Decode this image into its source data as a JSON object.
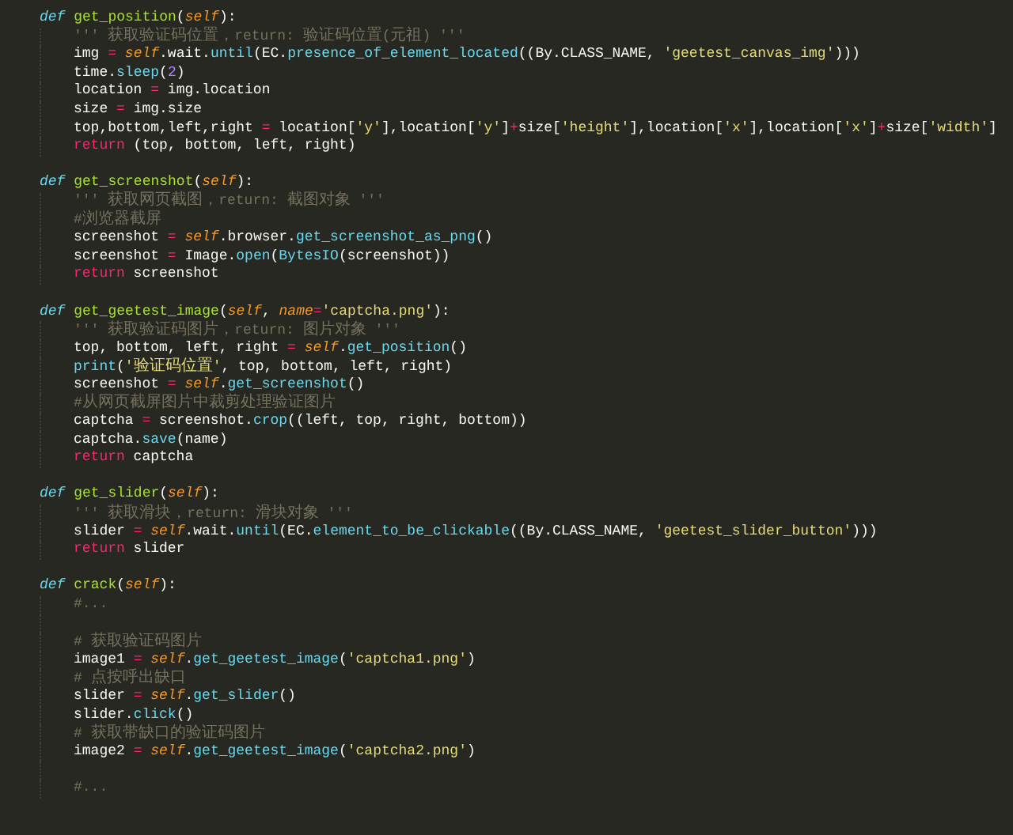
{
  "editor": {
    "lines": [
      {
        "kind": "code",
        "tokens": [
          {
            "kind": "kw",
            "text": "def "
          },
          {
            "kind": "fn",
            "text": "get_position"
          },
          {
            "kind": "plain",
            "text": "("
          },
          {
            "kind": "self",
            "text": "self"
          },
          {
            "kind": "plain",
            "text": "):"
          }
        ],
        "children": [
          {
            "kind": "code",
            "tokens": [
              {
                "kind": "cmt",
                "text": "''' 获取验证码位置，return: 验证码位置(元祖) '''"
              }
            ]
          },
          {
            "kind": "code",
            "tokens": [
              {
                "kind": "plain",
                "text": "img "
              },
              {
                "kind": "op",
                "text": "="
              },
              {
                "kind": "self",
                "text": " self"
              },
              {
                "kind": "plain",
                "text": ".wait."
              },
              {
                "kind": "call",
                "text": "until"
              },
              {
                "kind": "plain",
                "text": "(EC."
              },
              {
                "kind": "call",
                "text": "presence_of_element_located"
              },
              {
                "kind": "plain",
                "text": "((By.CLASS_NAME, "
              },
              {
                "kind": "str",
                "text": "'geetest_canvas_img'"
              },
              {
                "kind": "plain",
                "text": ")))"
              }
            ]
          },
          {
            "kind": "code",
            "tokens": [
              {
                "kind": "plain",
                "text": "time."
              },
              {
                "kind": "call",
                "text": "sleep"
              },
              {
                "kind": "plain",
                "text": "("
              },
              {
                "kind": "num",
                "text": "2"
              },
              {
                "kind": "plain",
                "text": ")"
              }
            ]
          },
          {
            "kind": "code",
            "tokens": [
              {
                "kind": "plain",
                "text": "location "
              },
              {
                "kind": "op",
                "text": "="
              },
              {
                "kind": "plain",
                "text": " img.location"
              }
            ]
          },
          {
            "kind": "code",
            "tokens": [
              {
                "kind": "plain",
                "text": "size "
              },
              {
                "kind": "op",
                "text": "="
              },
              {
                "kind": "plain",
                "text": " img.size"
              }
            ]
          },
          {
            "kind": "code",
            "tokens": [
              {
                "kind": "plain",
                "text": "top,bottom,left,right "
              },
              {
                "kind": "op",
                "text": "="
              },
              {
                "kind": "plain",
                "text": " location["
              },
              {
                "kind": "str",
                "text": "'y'"
              },
              {
                "kind": "plain",
                "text": "],location["
              },
              {
                "kind": "str",
                "text": "'y'"
              },
              {
                "kind": "plain",
                "text": "]"
              },
              {
                "kind": "op",
                "text": "+"
              },
              {
                "kind": "plain",
                "text": "size["
              },
              {
                "kind": "str",
                "text": "'height'"
              },
              {
                "kind": "plain",
                "text": "],location["
              },
              {
                "kind": "str",
                "text": "'x'"
              },
              {
                "kind": "plain",
                "text": "],location["
              },
              {
                "kind": "str",
                "text": "'x'"
              },
              {
                "kind": "plain",
                "text": "]"
              },
              {
                "kind": "op",
                "text": "+"
              },
              {
                "kind": "plain",
                "text": "size["
              },
              {
                "kind": "str",
                "text": "'width'"
              },
              {
                "kind": "plain",
                "text": "]"
              }
            ]
          },
          {
            "kind": "code",
            "tokens": [
              {
                "kind": "ret",
                "text": "return"
              },
              {
                "kind": "plain",
                "text": " (top, bottom, left, right)"
              }
            ]
          }
        ]
      },
      {
        "kind": "blank"
      },
      {
        "kind": "code",
        "tokens": [
          {
            "kind": "kw",
            "text": "def "
          },
          {
            "kind": "fn",
            "text": "get_screenshot"
          },
          {
            "kind": "plain",
            "text": "("
          },
          {
            "kind": "self",
            "text": "self"
          },
          {
            "kind": "plain",
            "text": "):"
          }
        ],
        "children": [
          {
            "kind": "code",
            "tokens": [
              {
                "kind": "cmt",
                "text": "''' 获取网页截图，return: 截图对象 '''"
              }
            ]
          },
          {
            "kind": "code",
            "tokens": [
              {
                "kind": "cmt",
                "text": "#浏览器截屏"
              }
            ]
          },
          {
            "kind": "code",
            "tokens": [
              {
                "kind": "plain",
                "text": "screenshot "
              },
              {
                "kind": "op",
                "text": "="
              },
              {
                "kind": "self",
                "text": " self"
              },
              {
                "kind": "plain",
                "text": ".browser."
              },
              {
                "kind": "call",
                "text": "get_screenshot_as_png"
              },
              {
                "kind": "plain",
                "text": "()"
              }
            ]
          },
          {
            "kind": "code",
            "tokens": [
              {
                "kind": "plain",
                "text": "screenshot "
              },
              {
                "kind": "op",
                "text": "="
              },
              {
                "kind": "plain",
                "text": " Image."
              },
              {
                "kind": "call",
                "text": "open"
              },
              {
                "kind": "plain",
                "text": "("
              },
              {
                "kind": "call",
                "text": "BytesIO"
              },
              {
                "kind": "plain",
                "text": "(screenshot))"
              }
            ]
          },
          {
            "kind": "code",
            "tokens": [
              {
                "kind": "ret",
                "text": "return"
              },
              {
                "kind": "plain",
                "text": " screenshot"
              }
            ]
          }
        ]
      },
      {
        "kind": "blank"
      },
      {
        "kind": "code",
        "tokens": [
          {
            "kind": "kw",
            "text": "def "
          },
          {
            "kind": "fn",
            "text": "get_geetest_image"
          },
          {
            "kind": "plain",
            "text": "("
          },
          {
            "kind": "self",
            "text": "self"
          },
          {
            "kind": "plain",
            "text": ", "
          },
          {
            "kind": "self",
            "text": "name"
          },
          {
            "kind": "op",
            "text": "="
          },
          {
            "kind": "str",
            "text": "'captcha.png'"
          },
          {
            "kind": "plain",
            "text": "):"
          }
        ],
        "children": [
          {
            "kind": "code",
            "tokens": [
              {
                "kind": "cmt",
                "text": "''' 获取验证码图片，return: 图片对象 '''"
              }
            ]
          },
          {
            "kind": "code",
            "tokens": [
              {
                "kind": "plain",
                "text": "top, bottom, left, right "
              },
              {
                "kind": "op",
                "text": "="
              },
              {
                "kind": "self",
                "text": " self"
              },
              {
                "kind": "plain",
                "text": "."
              },
              {
                "kind": "call",
                "text": "get_position"
              },
              {
                "kind": "plain",
                "text": "()"
              }
            ]
          },
          {
            "kind": "code",
            "tokens": [
              {
                "kind": "call",
                "text": "print"
              },
              {
                "kind": "plain",
                "text": "("
              },
              {
                "kind": "str",
                "text": "'验证码位置'"
              },
              {
                "kind": "plain",
                "text": ", top, bottom, left, right)"
              }
            ]
          },
          {
            "kind": "code",
            "tokens": [
              {
                "kind": "plain",
                "text": "screenshot "
              },
              {
                "kind": "op",
                "text": "="
              },
              {
                "kind": "self",
                "text": " self"
              },
              {
                "kind": "plain",
                "text": "."
              },
              {
                "kind": "call",
                "text": "get_screenshot"
              },
              {
                "kind": "plain",
                "text": "()"
              }
            ]
          },
          {
            "kind": "code",
            "tokens": [
              {
                "kind": "cmt",
                "text": "#从网页截屏图片中裁剪处理验证图片"
              }
            ]
          },
          {
            "kind": "code",
            "tokens": [
              {
                "kind": "plain",
                "text": "captcha "
              },
              {
                "kind": "op",
                "text": "="
              },
              {
                "kind": "plain",
                "text": " screenshot."
              },
              {
                "kind": "call",
                "text": "crop"
              },
              {
                "kind": "plain",
                "text": "((left, top, right, bottom))"
              }
            ]
          },
          {
            "kind": "code",
            "tokens": [
              {
                "kind": "plain",
                "text": "captcha."
              },
              {
                "kind": "call",
                "text": "save"
              },
              {
                "kind": "plain",
                "text": "(name)"
              }
            ]
          },
          {
            "kind": "code",
            "tokens": [
              {
                "kind": "ret",
                "text": "return"
              },
              {
                "kind": "plain",
                "text": " captcha"
              }
            ]
          }
        ]
      },
      {
        "kind": "blank"
      },
      {
        "kind": "code",
        "tokens": [
          {
            "kind": "kw",
            "text": "def "
          },
          {
            "kind": "fn",
            "text": "get_slider"
          },
          {
            "kind": "plain",
            "text": "("
          },
          {
            "kind": "self",
            "text": "self"
          },
          {
            "kind": "plain",
            "text": "):"
          }
        ],
        "children": [
          {
            "kind": "code",
            "tokens": [
              {
                "kind": "cmt",
                "text": "''' 获取滑块，return: 滑块对象 '''"
              }
            ]
          },
          {
            "kind": "code",
            "tokens": [
              {
                "kind": "plain",
                "text": "slider "
              },
              {
                "kind": "op",
                "text": "="
              },
              {
                "kind": "self",
                "text": " self"
              },
              {
                "kind": "plain",
                "text": ".wait."
              },
              {
                "kind": "call",
                "text": "until"
              },
              {
                "kind": "plain",
                "text": "(EC."
              },
              {
                "kind": "call",
                "text": "element_to_be_clickable"
              },
              {
                "kind": "plain",
                "text": "((By.CLASS_NAME, "
              },
              {
                "kind": "str",
                "text": "'geetest_slider_button'"
              },
              {
                "kind": "plain",
                "text": ")))"
              }
            ]
          },
          {
            "kind": "code",
            "tokens": [
              {
                "kind": "ret",
                "text": "return"
              },
              {
                "kind": "plain",
                "text": " slider"
              }
            ]
          }
        ]
      },
      {
        "kind": "blank"
      },
      {
        "kind": "code",
        "tokens": [
          {
            "kind": "kw",
            "text": "def "
          },
          {
            "kind": "fn",
            "text": "crack"
          },
          {
            "kind": "plain",
            "text": "("
          },
          {
            "kind": "self",
            "text": "self"
          },
          {
            "kind": "plain",
            "text": "):"
          }
        ],
        "children": [
          {
            "kind": "code",
            "tokens": [
              {
                "kind": "cmt",
                "text": "#..."
              }
            ]
          },
          {
            "kind": "blank"
          },
          {
            "kind": "code",
            "tokens": [
              {
                "kind": "cmt",
                "text": "# 获取验证码图片"
              }
            ]
          },
          {
            "kind": "code",
            "tokens": [
              {
                "kind": "plain",
                "text": "image1 "
              },
              {
                "kind": "op",
                "text": "="
              },
              {
                "kind": "self",
                "text": " self"
              },
              {
                "kind": "plain",
                "text": "."
              },
              {
                "kind": "call",
                "text": "get_geetest_image"
              },
              {
                "kind": "plain",
                "text": "("
              },
              {
                "kind": "str",
                "text": "'captcha1.png'"
              },
              {
                "kind": "plain",
                "text": ")"
              }
            ]
          },
          {
            "kind": "code",
            "tokens": [
              {
                "kind": "cmt",
                "text": "# 点按呼出缺口"
              }
            ]
          },
          {
            "kind": "code",
            "tokens": [
              {
                "kind": "plain",
                "text": "slider "
              },
              {
                "kind": "op",
                "text": "="
              },
              {
                "kind": "self",
                "text": " self"
              },
              {
                "kind": "plain",
                "text": "."
              },
              {
                "kind": "call",
                "text": "get_slider"
              },
              {
                "kind": "plain",
                "text": "()"
              }
            ]
          },
          {
            "kind": "code",
            "tokens": [
              {
                "kind": "plain",
                "text": "slider."
              },
              {
                "kind": "call",
                "text": "click"
              },
              {
                "kind": "plain",
                "text": "()"
              }
            ]
          },
          {
            "kind": "code",
            "tokens": [
              {
                "kind": "cmt",
                "text": "# 获取带缺口的验证码图片"
              }
            ]
          },
          {
            "kind": "code",
            "tokens": [
              {
                "kind": "plain",
                "text": "image2 "
              },
              {
                "kind": "op",
                "text": "="
              },
              {
                "kind": "self",
                "text": " self"
              },
              {
                "kind": "plain",
                "text": "."
              },
              {
                "kind": "call",
                "text": "get_geetest_image"
              },
              {
                "kind": "plain",
                "text": "("
              },
              {
                "kind": "str",
                "text": "'captcha2.png'"
              },
              {
                "kind": "plain",
                "text": ")"
              }
            ]
          },
          {
            "kind": "blank"
          },
          {
            "kind": "code",
            "tokens": [
              {
                "kind": "cmt",
                "text": "#..."
              }
            ]
          }
        ]
      }
    ]
  }
}
